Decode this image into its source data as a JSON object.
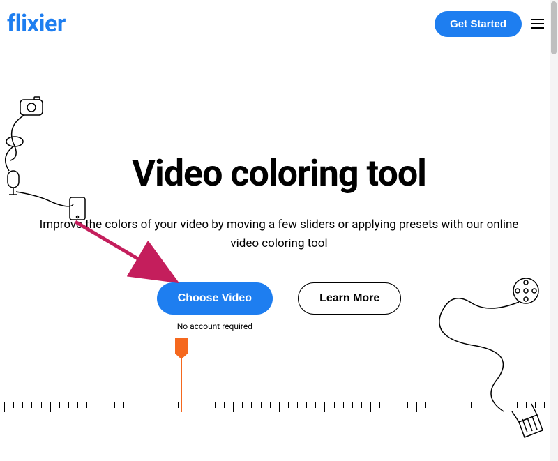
{
  "header": {
    "logo": "flixier",
    "get_started_label": "Get Started"
  },
  "hero": {
    "title": "Video coloring tool",
    "subtitle": "Improve the colors of your video by moving a few sliders or applying presets with our online video coloring tool",
    "choose_video_label": "Choose Video",
    "no_account_text": "No account required",
    "learn_more_label": "Learn More"
  },
  "colors": {
    "primary": "#1e7ef0",
    "accent": "#f5681e",
    "arrow": "#c41e5c"
  }
}
